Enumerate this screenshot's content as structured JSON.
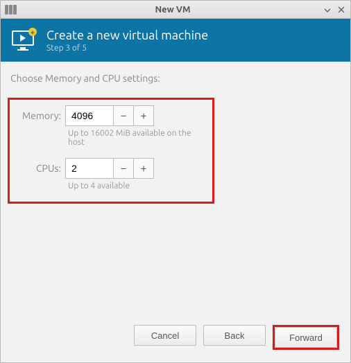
{
  "window": {
    "title": "New VM"
  },
  "banner": {
    "title": "Create a new virtual machine",
    "subtitle": "Step 3 of 5"
  },
  "content": {
    "section_label": "Choose Memory and CPU settings:",
    "memory": {
      "label": "Memory:",
      "value": "4096",
      "hint": "Up to 16002 MiB available on the host"
    },
    "cpus": {
      "label": "CPUs:",
      "value": "2",
      "hint": "Up to 4 available"
    }
  },
  "footer": {
    "cancel": "Cancel",
    "back": "Back",
    "forward": "Forward"
  }
}
